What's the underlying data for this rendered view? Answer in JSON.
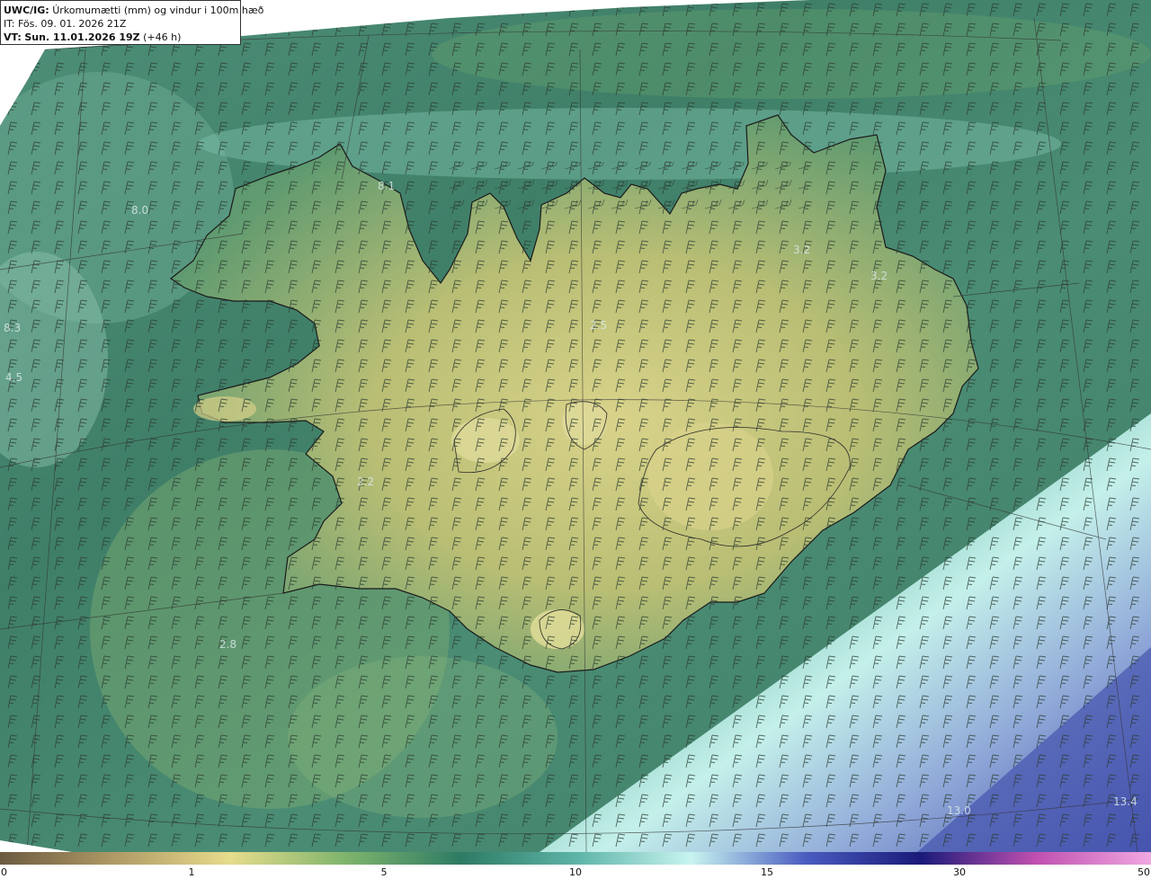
{
  "header": {
    "model": "UWC/IG:",
    "title": "Úrkomumætti (mm) og vindur i 100m hæð",
    "init_time": "IT: Fös. 09. 01. 2026 21Z",
    "valid_prefix": "VT:",
    "valid_time": "Sun. 11.01.2026 19Z",
    "lead": "(+46 h)"
  },
  "colorbar": {
    "ticks": [
      "0",
      "1",
      "5",
      "10",
      "15",
      "30",
      "50"
    ],
    "colors": [
      "#6b5a40",
      "#b09a66",
      "#e6dc8c",
      "#7fb46c",
      "#2e7b64",
      "#5cb3a6",
      "#c8f4f0",
      "#4a5cc0",
      "#1a1a78",
      "#c050b0",
      "#f0a8e0"
    ]
  },
  "map_labels": [
    "8.1",
    "8.0",
    "8.3",
    "4.5",
    "3.2",
    "3.2",
    "2.5",
    "2.2",
    "2.8",
    "13.0",
    "13.4"
  ],
  "colors": {
    "ocean_dark": "#3f7f66",
    "ocean_mid": "#4f9478",
    "land": "#b8bf72",
    "highland": "#d7d48a",
    "cyan_band": "#bfeee6",
    "deep_blue": "#4a58b0"
  }
}
